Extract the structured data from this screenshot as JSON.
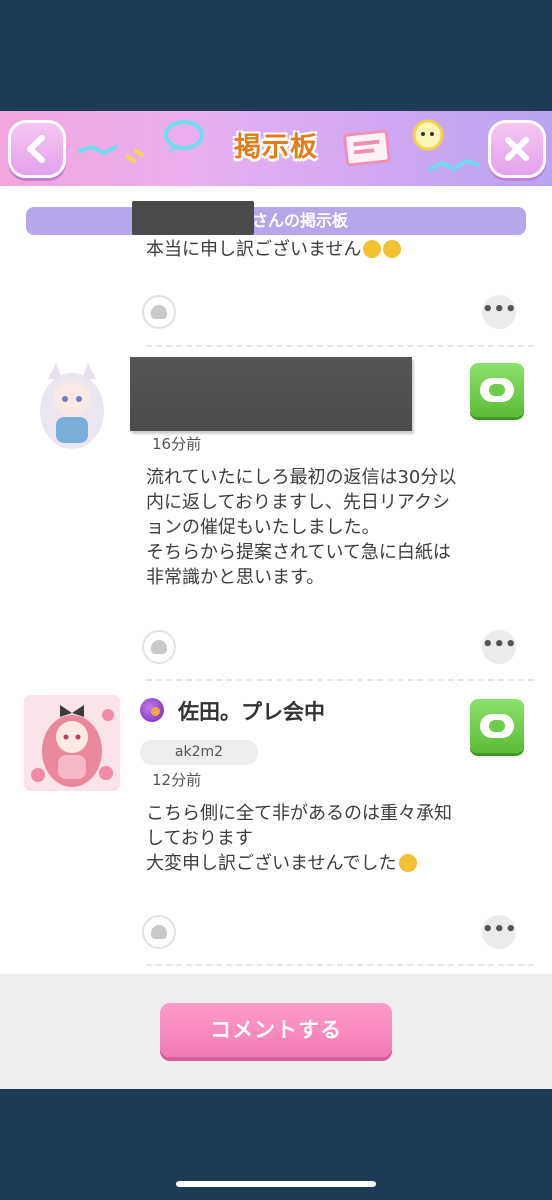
{
  "header": {
    "title": "掲示板"
  },
  "board": {
    "title_suffix": "さんの掲示板"
  },
  "posts": [
    {
      "message_lines": [
        "本当に申し訳ございません"
      ]
    },
    {
      "time": "16分前",
      "message_lines": [
        "流れていたにしろ最初の返信は30分以",
        "内に返しておりますし、先日リアクシ",
        "ョンの催促もいたしました。",
        "そちらから提案されていて急に白紙は",
        "非常識かと思います。"
      ]
    },
    {
      "user_name": "佐田。プレ会中",
      "user_id": "ak2m2",
      "time": "12分前",
      "message_lines": [
        "こちら側に全て非があるのは重々承知",
        "しております",
        "大変申し訳ございませんでした"
      ]
    }
  ],
  "footer": {
    "comment_label": "コメントする"
  },
  "colors": {
    "header_gradient_start": "#f3a6dd",
    "header_gradient_end": "#b9a5f2",
    "board_bar": "#b7a6ea",
    "title_orange": "#e07d1d",
    "reaction_green": "#6ccc47",
    "comment_pink": "#f27ab4",
    "outer_background": "#1e3a55"
  },
  "icons": [
    "back-icon",
    "close-icon",
    "speech-bubble-icon",
    "note-icon",
    "ghost-reaction-icon",
    "more-dots-icon",
    "reaction-icon",
    "user-badge-icon"
  ]
}
